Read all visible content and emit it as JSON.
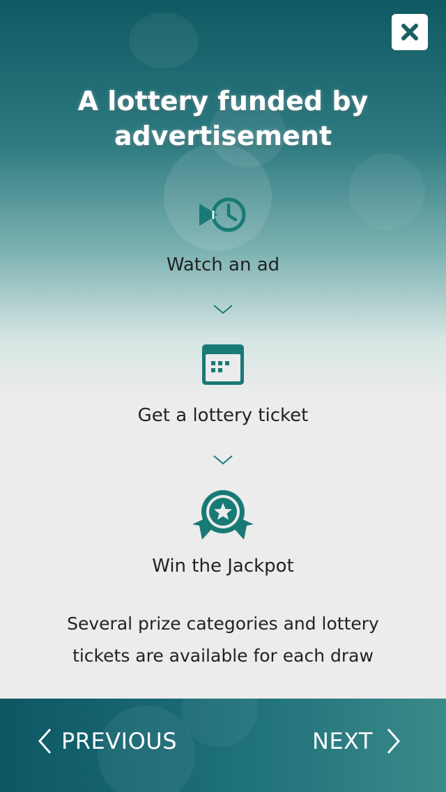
{
  "title": "A lottery funded by advertisement",
  "steps": [
    {
      "label": "Watch an ad",
      "icon": "play-history-icon"
    },
    {
      "label": "Get a lottery ticket",
      "icon": "ticket-calendar-icon"
    },
    {
      "label": "Win the Jackpot",
      "icon": "award-ribbon-icon"
    }
  ],
  "description": "Several prize categories and lottery tickets are available for each draw",
  "nav": {
    "previous_label": "PREVIOUS",
    "next_label": "NEXT"
  },
  "colors": {
    "accent": "#187a76",
    "text": "#222222",
    "header_dark": "#0f5963"
  }
}
